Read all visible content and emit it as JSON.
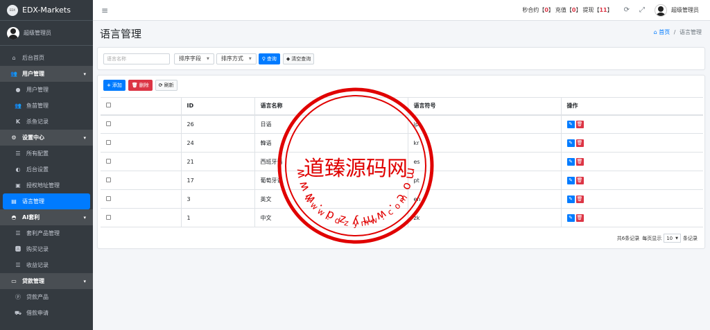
{
  "brand": {
    "logo_text": "EDX",
    "name": "EDX-Markets"
  },
  "user": {
    "name": "超级管理员"
  },
  "sidebar": {
    "items": [
      {
        "label": "后台首页",
        "icon": "home-icon",
        "type": "item"
      },
      {
        "label": "用户管理",
        "icon": "users-icon",
        "type": "group"
      },
      {
        "label": "用户管理",
        "icon": "user-icon",
        "type": "sub"
      },
      {
        "label": "鱼苗管理",
        "icon": "users-icon",
        "type": "sub"
      },
      {
        "label": "杀鱼记录",
        "icon": "k-icon",
        "type": "sub"
      },
      {
        "label": "设置中心",
        "icon": "cogs-icon",
        "type": "group"
      },
      {
        "label": "所有配置",
        "icon": "list-icon",
        "type": "sub"
      },
      {
        "label": "后台设置",
        "icon": "half-circle-icon",
        "type": "sub"
      },
      {
        "label": "授权地址管理",
        "icon": "id-card-icon",
        "type": "sub"
      },
      {
        "label": "语言管理",
        "icon": "language-icon",
        "type": "active"
      },
      {
        "label": "AI套利",
        "icon": "android-icon",
        "type": "group"
      },
      {
        "label": "套利产品管理",
        "icon": "list-icon",
        "type": "sub"
      },
      {
        "label": "购买记录",
        "icon": "a-icon",
        "type": "sub"
      },
      {
        "label": "收益记录",
        "icon": "list-icon",
        "type": "sub"
      },
      {
        "label": "贷款管理",
        "icon": "money-icon",
        "type": "group"
      },
      {
        "label": "贷款产品",
        "icon": "p-icon",
        "type": "sub"
      },
      {
        "label": "借款申请",
        "icon": "truck-icon",
        "type": "sub"
      }
    ]
  },
  "topbar": {
    "contract_label": "秒合约",
    "contract_count": "0",
    "recharge_label": "充值",
    "recharge_count": "0",
    "withdraw_label": "提现",
    "withdraw_count": "11",
    "admin_name": "超级管理员"
  },
  "page": {
    "title": "语言管理",
    "breadcrumb_home": "首页",
    "breadcrumb_sep": "/",
    "breadcrumb_current": "语言管理"
  },
  "filters": {
    "search_placeholder": "语言名称",
    "sort_field": "排序字段",
    "sort_order": "排序方式",
    "query_button": "查询",
    "clear_button": "清空查询"
  },
  "toolbar": {
    "add": "添加",
    "delete": "删除",
    "refresh": "刷新"
  },
  "table": {
    "headers": [
      "",
      "ID",
      "语言名称",
      "语言符号",
      "操作"
    ],
    "rows": [
      {
        "id": "26",
        "name": "日语",
        "code": "jp"
      },
      {
        "id": "24",
        "name": "韓语",
        "code": "kr"
      },
      {
        "id": "21",
        "name": "西班牙语",
        "code": "es"
      },
      {
        "id": "17",
        "name": "葡萄牙语",
        "code": "pt"
      },
      {
        "id": "3",
        "name": "英文",
        "code": "en"
      },
      {
        "id": "1",
        "name": "中文",
        "code": "zk"
      }
    ]
  },
  "pager": {
    "total": "共6条记录",
    "per_page_label": "每页显示",
    "page_size": "10",
    "suffix": "条记录"
  },
  "watermark": {
    "center_text": "道臻源码网",
    "ring_text": "www.dzymw.com",
    "color": "#e00000"
  },
  "colors": {
    "primary": "#007bff",
    "danger": "#dc3545",
    "sidebar_bg": "#343a40"
  }
}
